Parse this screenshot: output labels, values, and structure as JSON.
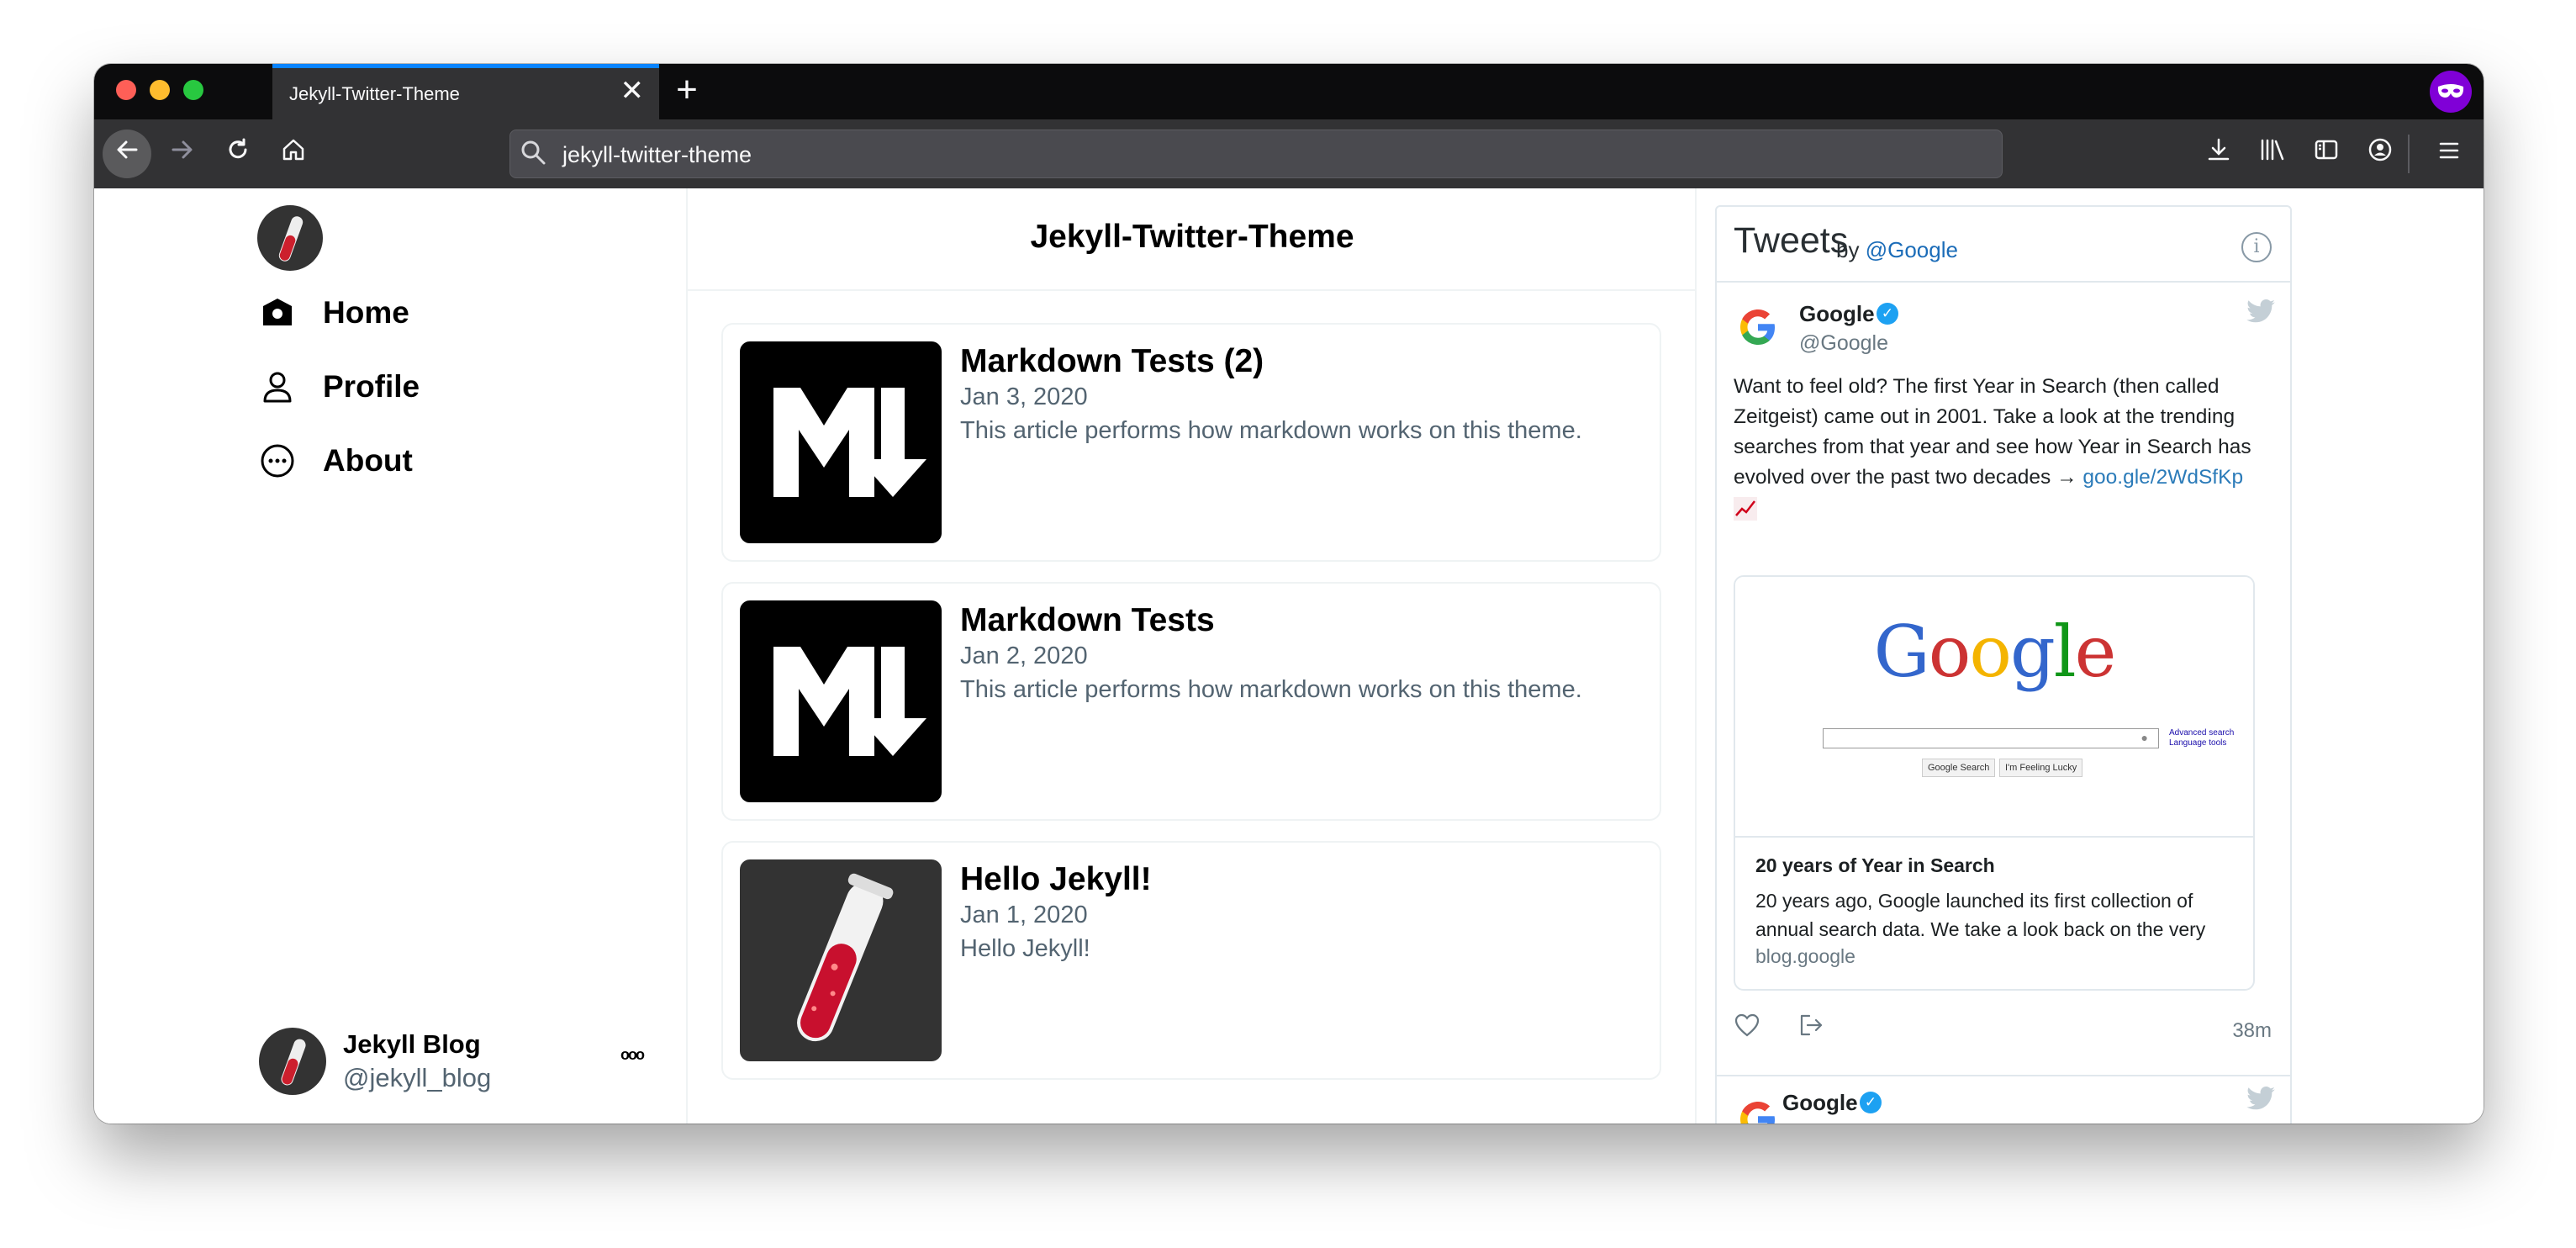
{
  "browser": {
    "tab_title": "Jekyll-Twitter-Theme",
    "tab_close": "✕",
    "new_tab": "+",
    "url": "jekyll-twitter-theme"
  },
  "sidebar": {
    "nav": [
      {
        "label": "Home",
        "icon": "home-icon"
      },
      {
        "label": "Profile",
        "icon": "profile-icon"
      },
      {
        "label": "About",
        "icon": "about-icon"
      }
    ],
    "profile": {
      "name": "Jekyll Blog",
      "handle": "@jekyll_blog",
      "more": "ooo"
    }
  },
  "main": {
    "title": "Jekyll-Twitter-Theme",
    "posts": [
      {
        "title": "Markdown Tests (2)",
        "date": "Jan 3, 2020",
        "desc": "This article performs how markdown works on this theme.",
        "image": "markdown-logo"
      },
      {
        "title": "Markdown Tests",
        "date": "Jan 2, 2020",
        "desc": "This article performs how markdown works on this theme.",
        "image": "markdown-logo"
      },
      {
        "title": "Hello Jekyll!",
        "date": "Jan 1, 2020",
        "desc": "Hello Jekyll!",
        "image": "jekyll-test-tube"
      }
    ]
  },
  "tweets": {
    "title": "Tweets",
    "by": "by",
    "by_handle": "@Google",
    "items": [
      {
        "name": "Google",
        "handle": "@Google",
        "text": "Want to feel old? The first Year in Search (then called Zeitgeist) came out in 2001. Take a look at the trending searches from that year and see how Year in Search has evolved over the past two decades →",
        "link": "goo.gle/2WdSfKp",
        "card": {
          "image_logo": "Google",
          "adv_search": "Advanced search",
          "lang_tools": "Language tools",
          "btn_search": "Google Search",
          "btn_lucky": "I'm Feeling Lucky",
          "title": "20 years of Year in Search",
          "desc": "20 years ago, Google launched its first collection of annual search data. We take a look back on the very",
          "domain": "blog.google"
        },
        "time": "38m"
      },
      {
        "name": "Google"
      }
    ]
  },
  "colors": {
    "accent": "#1da1f2",
    "muted": "#536471",
    "link": "#2b7bb9",
    "private_purple": "#8000d7"
  }
}
